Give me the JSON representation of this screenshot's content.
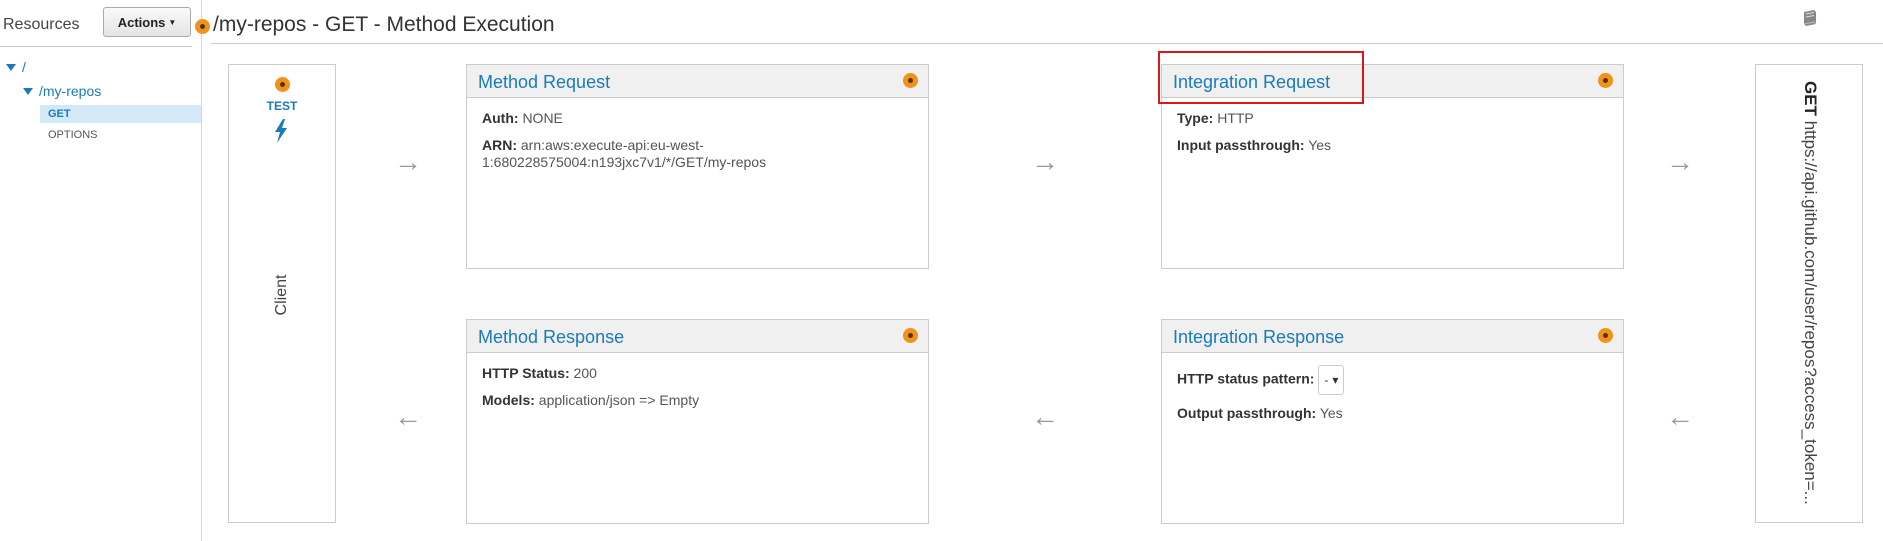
{
  "sidebar": {
    "title": "Resources",
    "actions_label": "Actions",
    "tree": {
      "root": "/",
      "child": "/my-repos",
      "methods": [
        "GET",
        "OPTIONS"
      ]
    }
  },
  "header": {
    "title": "/my-repos - GET - Method Execution"
  },
  "client": {
    "test_label": "TEST",
    "label": "Client"
  },
  "method_request": {
    "title": "Method Request",
    "auth_label": "Auth:",
    "auth_value": "NONE",
    "arn_label": "ARN:",
    "arn_value": "arn:aws:execute-api:eu-west-1:680228575004:n193jxc7v1/*/GET/my-repos"
  },
  "integration_request": {
    "title": "Integration Request",
    "type_label": "Type:",
    "type_value": "HTTP",
    "input_label": "Input passthrough:",
    "input_value": "Yes"
  },
  "method_response": {
    "title": "Method Response",
    "status_label": "HTTP Status:",
    "status_value": "200",
    "models_label": "Models:",
    "models_value": "application/json => Empty"
  },
  "integration_response": {
    "title": "Integration Response",
    "pattern_label": "HTTP status pattern:",
    "pattern_value": "-",
    "output_label": "Output passthrough:",
    "output_value": "Yes"
  },
  "endpoint": {
    "verb": "GET",
    "url": "https://api.github.com/user/repos?access_token=..."
  },
  "icons": {
    "arrow_right": "→",
    "arrow_left": "←",
    "dropdown": "▾"
  },
  "colors": {
    "accent": "#1a7bb9",
    "status_dot": "#f0921e",
    "highlight": "#d91818"
  }
}
